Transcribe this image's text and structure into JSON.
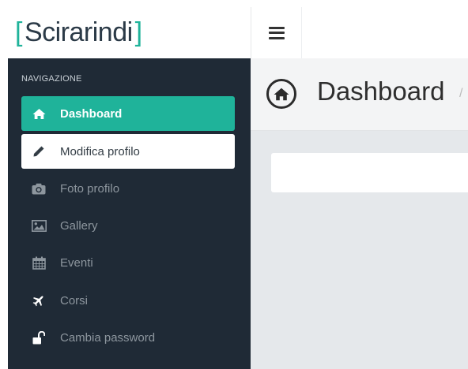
{
  "brand": {
    "open_bracket": "[",
    "name": "Scirarindi",
    "close_bracket": "]"
  },
  "sidebar": {
    "heading": "NAVIGAZIONE",
    "items": [
      {
        "label": "Dashboard",
        "icon": "home-icon",
        "state": "active"
      },
      {
        "label": "Modifica profilo",
        "icon": "pencil-icon",
        "state": "hovered"
      },
      {
        "label": "Foto profilo",
        "icon": "camera-icon",
        "state": "normal"
      },
      {
        "label": "Gallery",
        "icon": "picture-icon",
        "state": "normal"
      },
      {
        "label": "Eventi",
        "icon": "calendar-icon",
        "state": "normal"
      },
      {
        "label": "Corsi",
        "icon": "plane-icon",
        "state": "normal"
      },
      {
        "label": "Cambia password",
        "icon": "unlock-icon",
        "state": "normal"
      }
    ]
  },
  "header": {
    "title": "Dashboard",
    "breadcrumb_separator": "/"
  },
  "colors": {
    "accent": "#1fb39a",
    "sidebar_bg": "#1f2a36",
    "content_bg": "#e5e8eb"
  }
}
